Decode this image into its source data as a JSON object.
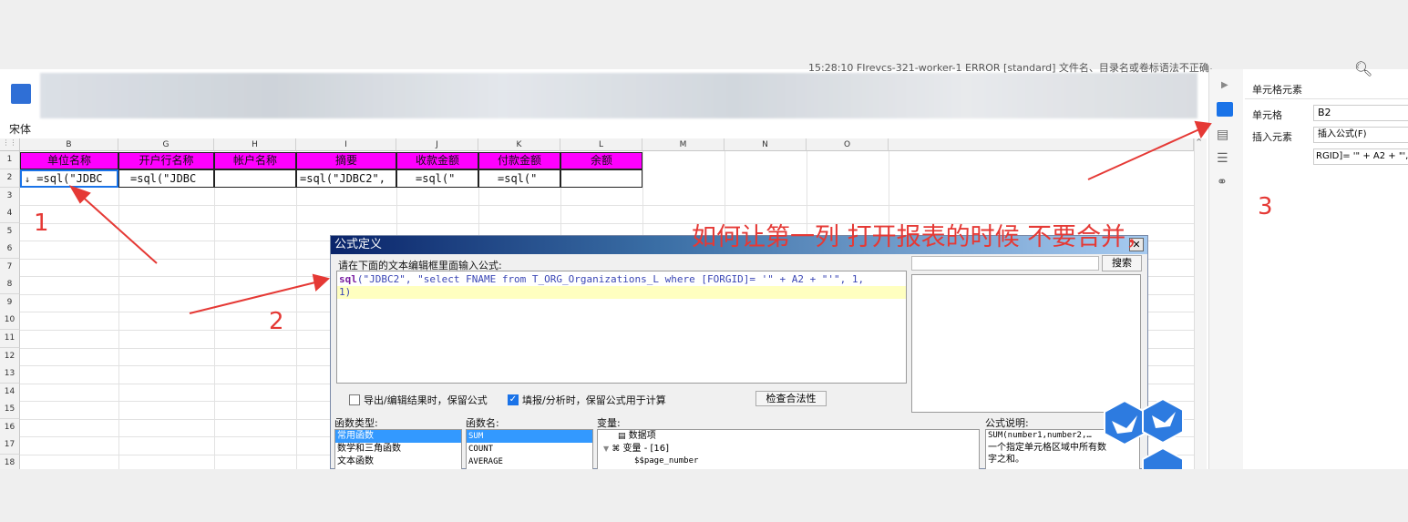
{
  "log_text": "15:28:10 FIrevcs-321-worker-1 ERROR [standard] 文件名、目录名或卷标语法不正确。",
  "font_name": "宋体",
  "columns": [
    "B",
    "G",
    "H",
    "I",
    "J",
    "K",
    "L",
    "M",
    "N",
    "O"
  ],
  "rows": [
    "1",
    "2",
    "3",
    "4",
    "5",
    "6",
    "7",
    "8",
    "9",
    "10",
    "11",
    "12",
    "13",
    "14",
    "15",
    "16",
    "17",
    "18"
  ],
  "header_cells": [
    "单位名称",
    "开户行名称",
    "帐户名称",
    "摘要",
    "收款金额",
    "付款金额",
    "余额"
  ],
  "data_cells": [
    "=sql(\"JDBC",
    "=sql(\"JDBC",
    "",
    "=sql(\"JDBC2\",",
    "=sql(\"",
    "=sql(\"",
    ""
  ],
  "annotation": {
    "question": "如何让第一列 打开报表的时候 不要合并，",
    "marker_1": "1",
    "marker_2": "2",
    "marker_3": "3"
  },
  "dialog": {
    "title": "公式定义",
    "prompt": "请在下面的文本编辑框里面输入公式:",
    "formula_fn": "sql",
    "formula_line1_rest": "(\"JDBC2\", \"select FNAME from T_ORG_Organizations_L where [FORGID]= '\" + A2 + \"'\", 1,",
    "formula_line2": "1)",
    "search_button": "搜索",
    "export_checkbox": "导出/编辑结果时，保留公式",
    "fill_checkbox": "填报/分析时，保留公式用于计算",
    "check_button": "检查合法性",
    "func_type_label": "函数类型:",
    "func_types": [
      "常用函数",
      "数学和三角函数",
      "文本函数"
    ],
    "func_name_label": "函数名:",
    "func_names": [
      "SUM",
      "COUNT",
      "AVERAGE"
    ],
    "var_label": "变量:",
    "var_items": [
      "数据项",
      "变量 - [16]",
      "$$page_number"
    ],
    "desc_label": "公式说明:",
    "desc_text": [
      "SUM(number1,number2,…",
      "一个指定单元格区域中所有数",
      "字之和。"
    ]
  },
  "side_panel": {
    "title": "单元格元素",
    "cell_label": "单元格",
    "cell_value": "B2",
    "insert_label": "插入元素",
    "insert_value": "插入公式(F)",
    "formula_preview": "RGID]= '\" + A2 + \"',"
  },
  "colors": {
    "header_fill": "#ff00ff",
    "annotation": "#e53935",
    "selection": "#1a73e8"
  }
}
